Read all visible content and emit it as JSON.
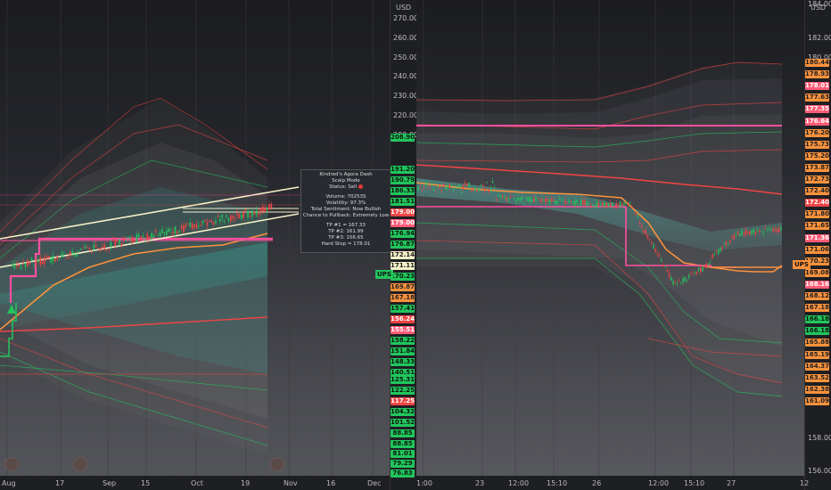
{
  "left_axis": {
    "currency": "USD",
    "ticks": [
      "270.00",
      "260.00",
      "250.00",
      "240.00",
      "230.00",
      "220.00",
      "200.00"
    ],
    "tags": [
      {
        "text": "208.90",
        "color": "#22c55e",
        "textColor": "#0a1a0a"
      },
      {
        "text": "191.20",
        "color": "#22c55e",
        "textColor": "#0a1a0a"
      },
      {
        "text": "190.79",
        "color": "#22c55e",
        "textColor": "#0a1a0a"
      },
      {
        "text": "186.33",
        "color": "#22c55e",
        "textColor": "#0a1a0a"
      },
      {
        "text": "181.51",
        "color": "#22c55e",
        "textColor": "#0a1a0a"
      },
      {
        "text": "179.00",
        "color": "#ef4444",
        "textColor": "#ffffff"
      },
      {
        "text": "179.00",
        "color": "#ff5c77",
        "textColor": "#ffffff"
      },
      {
        "text": "176.94",
        "color": "#22c55e",
        "textColor": "#0a1a0a"
      },
      {
        "text": "176.87",
        "color": "#22c55e",
        "textColor": "#0a1a0a"
      },
      {
        "text": "172.14",
        "color": "#f5f0c8",
        "textColor": "#222222"
      },
      {
        "text": "171.11",
        "color": "#f5f0c8",
        "textColor": "#222222"
      },
      {
        "text": "170.23",
        "color": "#22c55e",
        "textColor": "#0a1a0a"
      },
      {
        "text": "169.87",
        "color": "#fb923c",
        "textColor": "#222222"
      },
      {
        "text": "167.18",
        "color": "#fb923c",
        "textColor": "#222222"
      },
      {
        "text": "157.41",
        "color": "#22c55e",
        "textColor": "#0a1a0a"
      },
      {
        "text": "156.24",
        "color": "#ef4444",
        "textColor": "#ffffff"
      },
      {
        "text": "155.51",
        "color": "#ff5c77",
        "textColor": "#ffffff"
      },
      {
        "text": "158.22",
        "color": "#22c55e",
        "textColor": "#0a1a0a"
      },
      {
        "text": "151.84",
        "color": "#22c55e",
        "textColor": "#0a1a0a"
      },
      {
        "text": "148.33",
        "color": "#22c55e",
        "textColor": "#0a1a0a"
      },
      {
        "text": "140.51",
        "color": "#22c55e",
        "textColor": "#0a1a0a"
      },
      {
        "text": "125.31",
        "color": "#22c55e",
        "textColor": "#0a1a0a"
      },
      {
        "text": "122.25",
        "color": "#22c55e",
        "textColor": "#0a1a0a"
      },
      {
        "text": "117.25",
        "color": "#ef4444",
        "textColor": "#ffffff"
      },
      {
        "text": "104.32",
        "color": "#22c55e",
        "textColor": "#0a1a0a"
      },
      {
        "text": "101.52",
        "color": "#22c55e",
        "textColor": "#0a1a0a"
      },
      {
        "text": "88.85",
        "color": "#22c55e",
        "textColor": "#0a1a0a"
      },
      {
        "text": "88.85",
        "color": "#22c55e",
        "textColor": "#0a1a0a"
      },
      {
        "text": "81.01",
        "color": "#22c55e",
        "textColor": "#0a1a0a"
      },
      {
        "text": "79.29",
        "color": "#22c55e",
        "textColor": "#0a1a0a"
      },
      {
        "text": "76.83",
        "color": "#22c55e",
        "textColor": "#0a1a0a"
      }
    ],
    "ups_label": "UPS"
  },
  "right_axis": {
    "currency": "USD",
    "top_value": "184.00",
    "ticks": [
      "182.00",
      "180.00",
      "158.00",
      "156.00"
    ],
    "tags": [
      {
        "text": "180.44",
        "color": "#fb923c",
        "textColor": "#222222"
      },
      {
        "text": "178.93",
        "color": "#fb923c",
        "textColor": "#222222"
      },
      {
        "text": "178.01",
        "color": "#ff5c77",
        "textColor": "#ffffff"
      },
      {
        "text": "177.63",
        "color": "#fb923c",
        "textColor": "#222222"
      },
      {
        "text": "177.35",
        "color": "#ff5c77",
        "textColor": "#ffffff"
      },
      {
        "text": "176.64",
        "color": "#ff5c77",
        "textColor": "#ffffff"
      },
      {
        "text": "176.20",
        "color": "#fb923c",
        "textColor": "#222222"
      },
      {
        "text": "175.73",
        "color": "#fb923c",
        "textColor": "#222222"
      },
      {
        "text": "175.20",
        "color": "#fb923c",
        "textColor": "#222222"
      },
      {
        "text": "173.87",
        "color": "#fb923c",
        "textColor": "#222222"
      },
      {
        "text": "172.73",
        "color": "#fb923c",
        "textColor": "#222222"
      },
      {
        "text": "172.40",
        "color": "#fb923c",
        "textColor": "#222222"
      },
      {
        "text": "172.40",
        "color": "#ef4444",
        "textColor": "#ffffff"
      },
      {
        "text": "171.80",
        "color": "#fb923c",
        "textColor": "#222222"
      },
      {
        "text": "171.65",
        "color": "#fb923c",
        "textColor": "#222222"
      },
      {
        "text": "171.36",
        "color": "#ff5c77",
        "textColor": "#ffffff"
      },
      {
        "text": "171.06",
        "color": "#fb923c",
        "textColor": "#222222"
      },
      {
        "text": "170.23",
        "color": "#fb923c",
        "textColor": "#222222"
      },
      {
        "text": "169.08",
        "color": "#fb923c",
        "textColor": "#222222"
      },
      {
        "text": "168.16",
        "color": "#ff5c77",
        "textColor": "#ffffff"
      },
      {
        "text": "168.12",
        "color": "#fb923c",
        "textColor": "#222222"
      },
      {
        "text": "167.18",
        "color": "#fb923c",
        "textColor": "#222222"
      },
      {
        "text": "166.18",
        "color": "#22c55e",
        "textColor": "#0a1a0a"
      },
      {
        "text": "166.18",
        "color": "#22c55e",
        "textColor": "#0a1a0a"
      },
      {
        "text": "165.88",
        "color": "#fb923c",
        "textColor": "#222222"
      },
      {
        "text": "165.19",
        "color": "#fb923c",
        "textColor": "#222222"
      },
      {
        "text": "164.37",
        "color": "#fb923c",
        "textColor": "#222222"
      },
      {
        "text": "163.52",
        "color": "#fb923c",
        "textColor": "#222222"
      },
      {
        "text": "162.38",
        "color": "#fb923c",
        "textColor": "#222222"
      },
      {
        "text": "161.09",
        "color": "#fb923c",
        "textColor": "#222222"
      }
    ],
    "ups_label": "UPS"
  },
  "left_xaxis": [
    "Aug",
    "17",
    "Sep",
    "15",
    "Oct",
    "19",
    "Nov",
    "16",
    "Dec"
  ],
  "right_xaxis": [
    "1:00",
    "23",
    "12:00",
    "15:10",
    "26",
    "12:00",
    "15:10",
    "27",
    "12"
  ],
  "info_panel": {
    "title": "Kindred's Agora Dash",
    "mode": "Scalp Mode",
    "status": "Status: Sell",
    "volume": "Volume: 70253S",
    "volatility": "Volatility: 97.3%",
    "sentiment": "Total Sentiment: Now Bullish",
    "pullback": "Chance to Pullback: Extremely Low",
    "tp1": "TP #1 = 167.33",
    "tp2": "TP #2: 161.99",
    "tp3": "TP #3: 156.65",
    "hard_stop": "Hard Stop = 178.01"
  },
  "colors": {
    "bull": "#22c55e",
    "bear": "#ef4444",
    "pink": "#ff4fa0",
    "orange": "#fb923c",
    "cream": "#f5f0c8",
    "teal": "#2dd4bf"
  }
}
